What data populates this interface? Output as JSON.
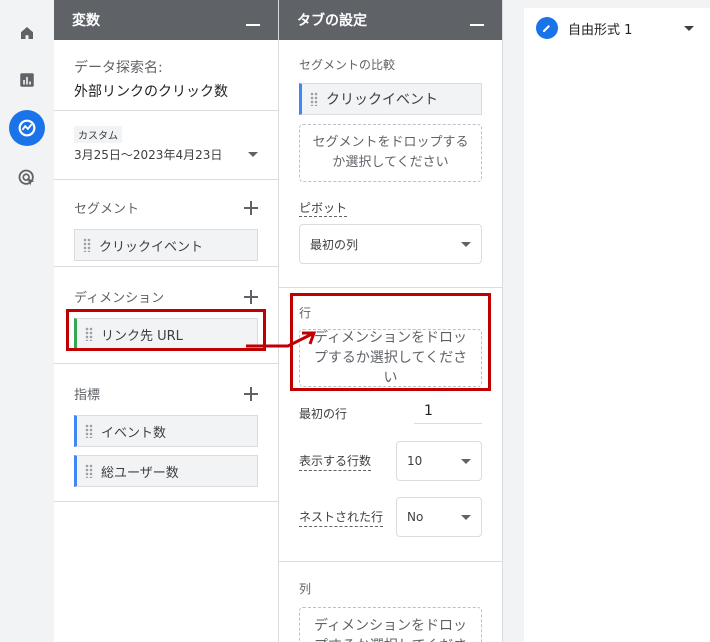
{
  "nav": {
    "items": [
      {
        "icon": "home-icon"
      },
      {
        "icon": "reports-icon"
      },
      {
        "icon": "explore-icon"
      },
      {
        "icon": "advertising-icon"
      }
    ]
  },
  "variables": {
    "header": "変数",
    "exploration_label": "データ探索名:",
    "exploration_name": "外部リンクのクリック数",
    "date_badge": "カスタム",
    "date_range": "3月25日～2023年4月23日",
    "segments_label": "セグメント",
    "segments": [
      "クリックイベント"
    ],
    "dimensions_label": "ディメンション",
    "dimensions": [
      "リンク先 URL"
    ],
    "metrics_label": "指標",
    "metrics": [
      "イベント数",
      "総ユーザー数"
    ]
  },
  "tab_settings": {
    "header": "タブの設定",
    "segment_compare_label": "セグメントの比較",
    "segment_compare_chip": "クリックイベント",
    "segment_drop": "セグメントをドロップするか選択してください",
    "pivot_label": "ピボット",
    "pivot_value": "最初の列",
    "rows_label": "行",
    "rows_drop": "ディメンションをドロップするか選択してください",
    "first_row_label": "最初の行",
    "first_row_value": "1",
    "show_rows_label": "表示する行数",
    "show_rows_value": "10",
    "nested_rows_label": "ネストされた行",
    "nested_rows_value": "No",
    "columns_label": "列",
    "columns_drop": "ディメンションをドロップするか選択してください"
  },
  "canvas": {
    "tab_name": "自由形式 1"
  },
  "colors": {
    "header_bg": "#5f6368",
    "accent_blue": "#1a73e8",
    "highlight_red": "#c00000"
  }
}
